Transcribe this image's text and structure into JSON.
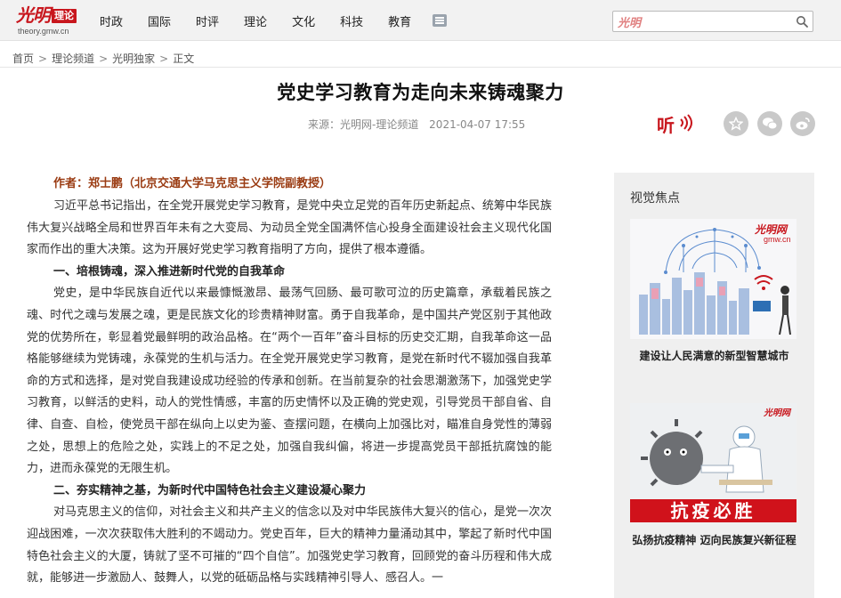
{
  "header": {
    "logo_mark": "光明",
    "logo_badge": "理论",
    "logo_url": "theory.gmw.cn",
    "nav": [
      "时政",
      "国际",
      "时评",
      "理论",
      "文化",
      "科技",
      "教育"
    ],
    "search": {
      "logo": "光明",
      "placeholder": ""
    }
  },
  "breadcrumb": [
    "首页",
    "理论频道",
    "光明独家",
    "正文"
  ],
  "article": {
    "title": "党史学习教育为走向未来铸魂聚力",
    "source": "来源：光明网-理论频道",
    "date": "2021-04-07 17:55",
    "listen_label": "听",
    "author": "作者：郑士鹏（北京交通大学马克思主义学院副教授）",
    "blocks": [
      {
        "type": "para",
        "text": "习近平总书记指出，在全党开展党史学习教育，是党中央立足党的百年历史新起点、统筹中华民族伟大复兴战略全局和世界百年未有之大变局、为动员全党全国满怀信心投身全面建设社会主义现代化国家而作出的重大决策。这为开展好党史学习教育指明了方向，提供了根本遵循。"
      },
      {
        "type": "heading",
        "text": "一、培根铸魂，深入推进新时代党的自我革命"
      },
      {
        "type": "para",
        "text": "党史，是中华民族自近代以来最慷慨激昂、最荡气回肠、最可歌可泣的历史篇章，承载着民族之魂、时代之魂与发展之魂，更是民族文化的珍贵精神财富。勇于自我革命，是中国共产党区别于其他政党的优势所在，彰显着党最鲜明的政治品格。在“两个一百年”奋斗目标的历史交汇期，自我革命这一品格能够继续为党铸魂，永葆党的生机与活力。在全党开展党史学习教育，是党在新时代不辍加强自我革命的方式和选择，是对党自我建设成功经验的传承和创新。在当前复杂的社会思潮激荡下，加强党史学习教育，以鲜活的史料，动人的党性情感，丰富的历史情怀以及正确的党史观，引导党员干部自省、自律、自查、自检，使党员干部在纵向上以史为鉴、查摆问题，在横向上加强比对，瞄准自身党性的薄弱之处，思想上的危险之处，实践上的不足之处，加强自我纠偏，将进一步提高党员干部抵抗腐蚀的能力，进而永葆党的无限生机。"
      },
      {
        "type": "heading",
        "text": "二、夯实精神之基，为新时代中国特色社会主义建设凝心聚力"
      },
      {
        "type": "para",
        "text": "对马克思主义的信仰，对社会主义和共产主义的信念以及对中华民族伟大复兴的信心，是党一次次迎战困难，一次次获取伟大胜利的不竭动力。党史百年，巨大的精神力量涌动其中，擎起了新时代中国特色社会主义的大厦，铸就了坚不可摧的“四个自信”。加强党史学习教育，回顾党的奋斗历程和伟大成就，能够进一步激励人、鼓舞人，以党的砥砺品格与实践精神引导人、感召人。一"
      }
    ]
  },
  "sidebar": {
    "title": "视觉焦点",
    "cards": [
      {
        "caption": "建设让人民满意的新型智慧城市",
        "badge": "光明网",
        "badge_url": "gmw.cn"
      },
      {
        "caption": "弘扬抗疫精神 迈向民族复兴新征程",
        "banner": "抗疫必胜",
        "badge": "光明网"
      }
    ]
  },
  "colors": {
    "brand_red": "#c8161d",
    "author_brown": "#9a3b12",
    "sidebar_bg": "#efefef"
  }
}
